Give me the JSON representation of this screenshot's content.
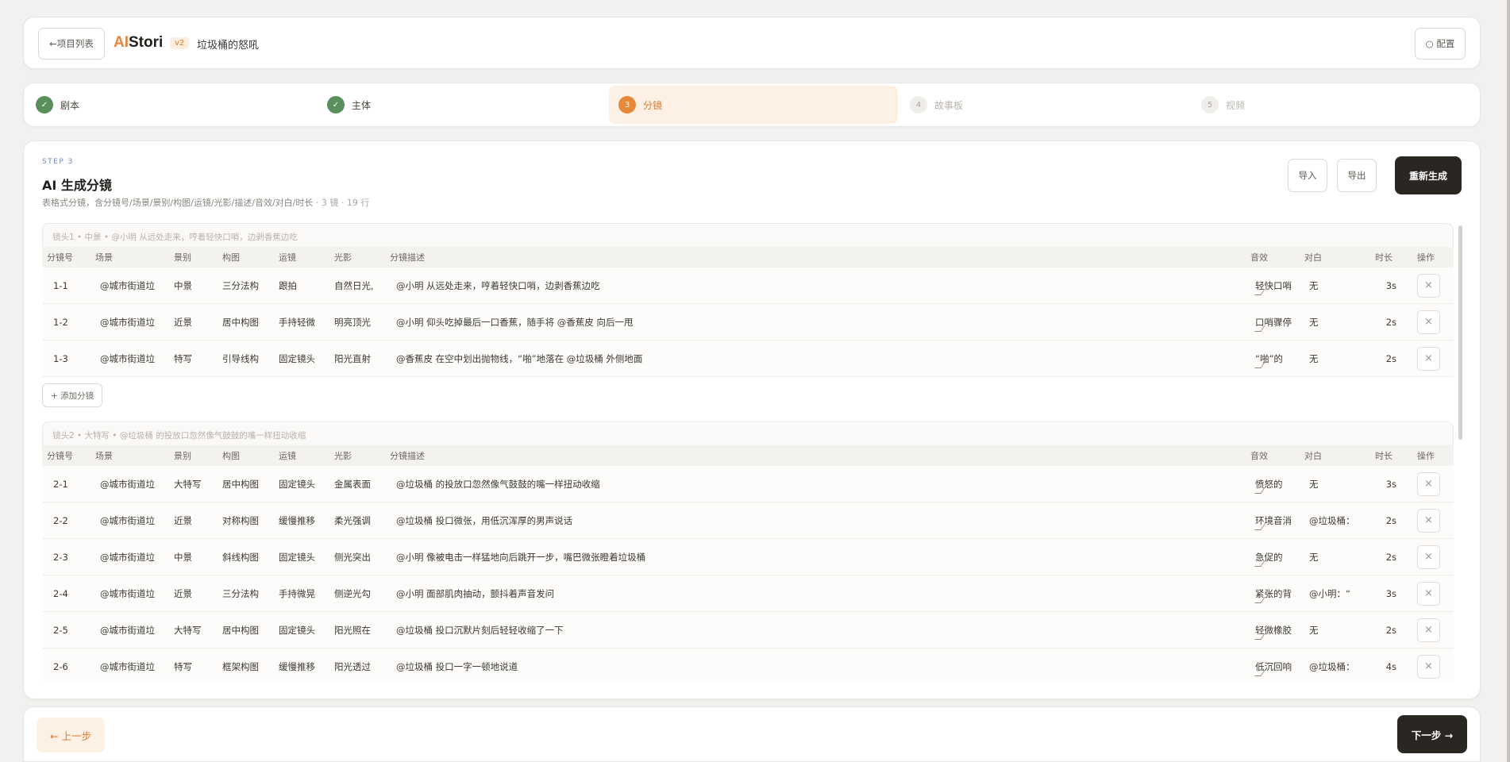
{
  "header": {
    "back_label": "←项目列表",
    "brand_ai": "AI",
    "brand_rest": "Stori",
    "version": "v2",
    "project_name": "垃圾桶的怒吼",
    "config_label": "○ 配置"
  },
  "steps": [
    {
      "num": "✓",
      "label": "剧本",
      "state": "done"
    },
    {
      "num": "✓",
      "label": "主体",
      "state": "done"
    },
    {
      "num": "3",
      "label": "分镜",
      "state": "current"
    },
    {
      "num": "4",
      "label": "故事板",
      "state": "todo"
    },
    {
      "num": "5",
      "label": "视频",
      "state": "todo"
    }
  ],
  "main": {
    "step_tag": "STEP 3",
    "title": "AI 生成分镜",
    "subtitle": "表格式分镜，含分镜号/场景/景别/构图/运镜/光影/描述/音效/对白/时长",
    "subtitle_meta": " · 3 镜 · 19 行",
    "import_label": "导入",
    "export_label": "导出",
    "regen_label": "重新生成",
    "add_shot_label": "+ 添加分镜"
  },
  "columns": [
    "分镜号",
    "场景",
    "景别",
    "构图",
    "运镜",
    "光影",
    "分镜描述",
    "音效",
    "对白",
    "时长",
    "操作"
  ],
  "shots": [
    {
      "header": "镜头1 • 中景 • @小明 从远处走来，哼着轻快口哨，边剥香蕉边吃",
      "rows": [
        {
          "no": "1-1",
          "scene": "@城市街道垃",
          "type": "中景",
          "comp": "三分法构",
          "move": "跟拍",
          "light": "自然日光,",
          "desc": "@小明 从远处走来，哼着轻快口哨，边剥香蕉边吃",
          "sfx": "轻快口哨",
          "dialog": "无",
          "dur": "3s"
        },
        {
          "no": "1-2",
          "scene": "@城市街道垃",
          "type": "近景",
          "comp": "居中构图",
          "move": "手持轻微",
          "light": "明亮顶光",
          "desc": "@小明 仰头吃掉最后一口香蕉，随手将 @香蕉皮 向后一甩",
          "sfx": "口哨骤停",
          "dialog": "无",
          "dur": "2s"
        },
        {
          "no": "1-3",
          "scene": "@城市街道垃",
          "type": "特写",
          "comp": "引导线构",
          "move": "固定镜头",
          "light": "阳光直射",
          "desc": "@香蕉皮 在空中划出抛物线，“啪”地落在 @垃圾桶 外侧地面",
          "sfx": "“啪”的",
          "dialog": "无",
          "dur": "2s"
        }
      ]
    },
    {
      "header": "镜头2 • 大特写 • @垃圾桶 的投放口忽然像气鼓鼓的嘴一样扭动收缩",
      "rows": [
        {
          "no": "2-1",
          "scene": "@城市街道垃",
          "type": "大特写",
          "comp": "居中构图",
          "move": "固定镜头",
          "light": "金属表面",
          "desc": "@垃圾桶 的投放口忽然像气鼓鼓的嘴一样扭动收缩",
          "sfx": "愤怒的",
          "dialog": "无",
          "dur": "3s"
        },
        {
          "no": "2-2",
          "scene": "@城市街道垃",
          "type": "近景",
          "comp": "对称构图",
          "move": "缓慢推移",
          "light": "柔光强调",
          "desc": "@垃圾桶 投口微张，用低沉浑厚的男声说话",
          "sfx": "环境音消",
          "dialog": "@垃圾桶：",
          "dur": "2s"
        },
        {
          "no": "2-3",
          "scene": "@城市街道垃",
          "type": "中景",
          "comp": "斜线构图",
          "move": "固定镜头",
          "light": "侧光突出",
          "desc": "@小明 像被电击一样猛地向后跳开一步，嘴巴微张瞪着垃圾桶",
          "sfx": "急促的",
          "dialog": "无",
          "dur": "2s"
        },
        {
          "no": "2-4",
          "scene": "@城市街道垃",
          "type": "近景",
          "comp": "三分法构",
          "move": "手持微晃",
          "light": "侧逆光勾",
          "desc": "@小明 面部肌肉抽动，颤抖着声音发问",
          "sfx": "紧张的背",
          "dialog": "@小明：“",
          "dur": "3s"
        },
        {
          "no": "2-5",
          "scene": "@城市街道垃",
          "type": "大特写",
          "comp": "居中构图",
          "move": "固定镜头",
          "light": "阳光照在",
          "desc": "@垃圾桶 投口沉默片刻后轻轻收缩了一下",
          "sfx": "轻微橡胶",
          "dialog": "无",
          "dur": "2s"
        },
        {
          "no": "2-6",
          "scene": "@城市街道垃",
          "type": "特写",
          "comp": "框架构图",
          "move": "缓慢推移",
          "light": "阳光透过",
          "desc": "@垃圾桶 投口一字一顿地说道",
          "sfx": "低沉回响",
          "dialog": "@垃圾桶：",
          "dur": "4s"
        }
      ]
    }
  ],
  "footer": {
    "prev_label": "← 上一步",
    "next_label": "下一步 →"
  },
  "icons": {
    "close": "close-icon",
    "check": "check-icon"
  },
  "colors": {
    "accent": "#e8883a",
    "done": "#5a8f5c",
    "dark": "#2a2622",
    "link_blue": "#6b86b8"
  }
}
